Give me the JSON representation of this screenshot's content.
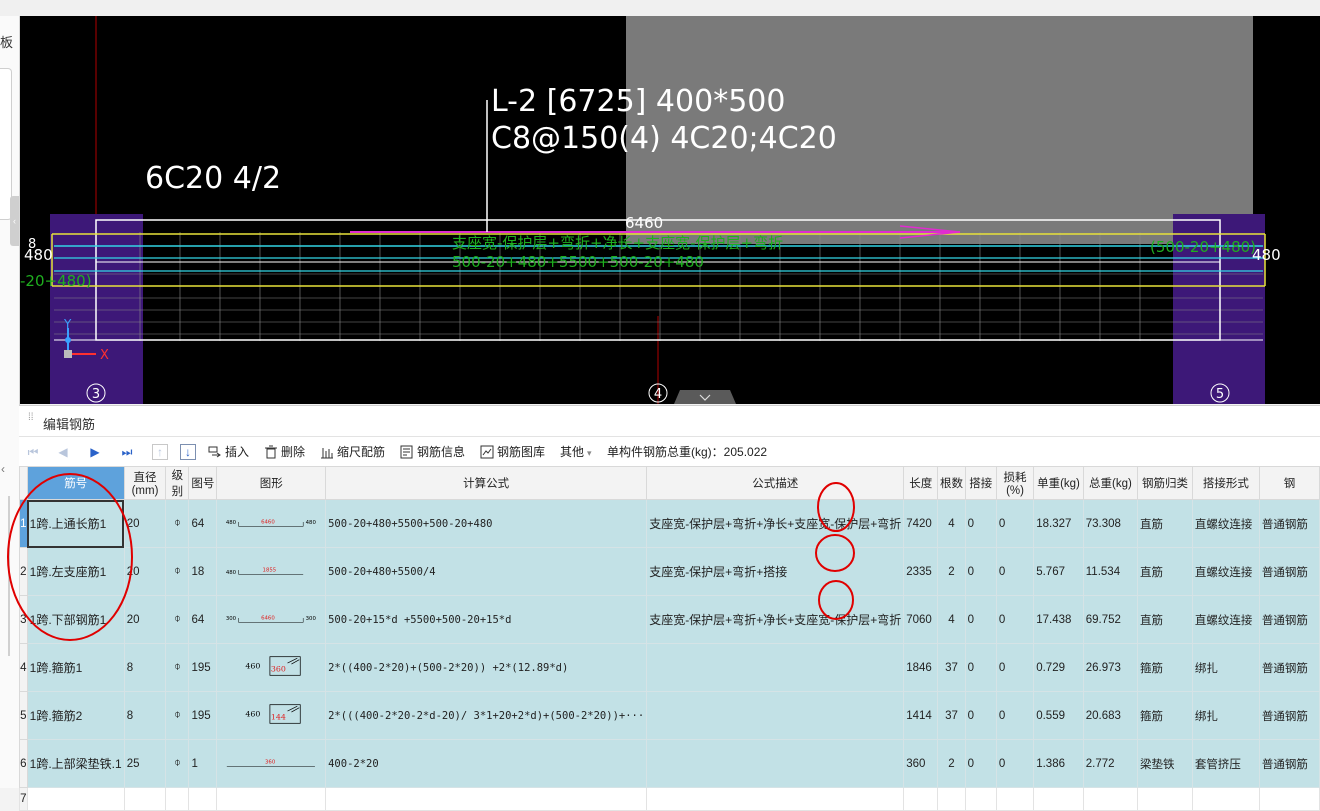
{
  "left_panel": {
    "label": "板",
    "tab_glyph": "‹",
    "chevron": "‹"
  },
  "cad": {
    "beam_label_line1": "L-2 [6725] 400*500",
    "beam_label_line2": "C8@150(4) 4C20;4C20",
    "support_label": "6C20 4/2",
    "span_length": "6460",
    "left_dim": "480",
    "right_dim": "480",
    "left_formula_frag": "-20+480)",
    "right_formula_frag": "(500-20+480)",
    "green_line1": "支座宽-保护层+弯折+净长+支座宽-保护层+弯折",
    "green_line2": "500-20+480+5500+500-20+480",
    "left_frag_b": "8",
    "axis_left": "3",
    "axis_mid": "4",
    "axis_right": "5",
    "axis_x": "X",
    "axis_y": "Y",
    "colors": {
      "support": "#3d1878",
      "support_edge": "#6a3bb4",
      "rebar_yellow": "#e8e23a",
      "rebar_cyan": "#33d6e6",
      "rebar_magenta": "#e02cd0",
      "green_text": "#1fae1f",
      "grid_red": "#b00000",
      "overlay_gray": "#7a7a7a"
    }
  },
  "panel": {
    "title": "编辑钢筋",
    "toolbar": {
      "first": "⏮",
      "prev": "◀",
      "next": "▶",
      "last": "⏭",
      "move_up": "↑",
      "move_down": "↓",
      "insert": "插入",
      "delete": "删除",
      "scale_rebar": "缩尺配筋",
      "rebar_info": "钢筋信息",
      "rebar_library": "钢筋图库",
      "other": "其他",
      "total_weight": "单构件钢筋总重(kg)：205.022"
    },
    "columns": [
      "筋号",
      "直径(mm)",
      "级别",
      "图号",
      "图形",
      "计算公式",
      "公式描述",
      "长度",
      "根数",
      "搭接",
      "损耗(%)",
      "单重(kg)",
      "总重(kg)",
      "钢筋归类",
      "搭接形式",
      "钢"
    ],
    "rows": [
      {
        "num": "1",
        "name": "1跨.上通长筋1",
        "dia": "20",
        "grade": "⌽",
        "fig": "64",
        "shape_left": "480",
        "shape_mid": "6460",
        "shape_right": "480",
        "formula": "500-20+480+5500+500-20+480",
        "desc": "支座宽-保护层+弯折+净长+支座宽-保护层+弯折",
        "len": "7420",
        "count": "4",
        "lap": "0",
        "loss": "0",
        "unit_w": "18.327",
        "total_w": "73.308",
        "category": "直筋",
        "lap_type": "直螺纹连接",
        "steel": "普通钢筋"
      },
      {
        "num": "2",
        "name": "1跨.左支座筋1",
        "dia": "20",
        "grade": "⌽",
        "fig": "18",
        "shape_left": "480",
        "shape_mid": "1855",
        "shape_right": "",
        "formula": "500-20+480+5500/4",
        "desc": "支座宽-保护层+弯折+搭接",
        "len": "2335",
        "count": "2",
        "lap": "0",
        "loss": "0",
        "unit_w": "5.767",
        "total_w": "11.534",
        "category": "直筋",
        "lap_type": "直螺纹连接",
        "steel": "普通钢筋"
      },
      {
        "num": "3",
        "name": "1跨.下部钢筋1",
        "dia": "20",
        "grade": "⌽",
        "fig": "64",
        "shape_left": "300",
        "shape_mid": "6460",
        "shape_right": "300",
        "formula": "500-20+15*d +5500+500-20+15*d",
        "desc": "支座宽-保护层+弯折+净长+支座宽-保护层+弯折",
        "len": "7060",
        "count": "4",
        "lap": "0",
        "loss": "0",
        "unit_w": "17.438",
        "total_w": "69.752",
        "category": "直筋",
        "lap_type": "直螺纹连接",
        "steel": "普通钢筋"
      },
      {
        "num": "4",
        "name": "1跨.箍筋1",
        "dia": "8",
        "grade": "⌽",
        "fig": "195",
        "shape_left": "460",
        "shape_mid": "360",
        "shape_right": "",
        "formula": "2*((400-2*20)+(500-2*20)) +2*(12.89*d)",
        "desc": "",
        "len": "1846",
        "count": "37",
        "lap": "0",
        "loss": "0",
        "unit_w": "0.729",
        "total_w": "26.973",
        "category": "箍筋",
        "lap_type": "绑扎",
        "steel": "普通钢筋"
      },
      {
        "num": "5",
        "name": "1跨.箍筋2",
        "dia": "8",
        "grade": "⌽",
        "fig": "195",
        "shape_left": "460",
        "shape_mid": "144",
        "shape_right": "",
        "formula": "2*(((400-2*20-2*d-20)/ 3*1+20+2*d)+(500-2*20))+···",
        "desc": "",
        "len": "1414",
        "count": "37",
        "lap": "0",
        "loss": "0",
        "unit_w": "0.559",
        "total_w": "20.683",
        "category": "箍筋",
        "lap_type": "绑扎",
        "steel": "普通钢筋"
      },
      {
        "num": "6",
        "name": "1跨.上部梁垫铁.1",
        "dia": "25",
        "grade": "⌽",
        "fig": "1",
        "shape_left": "",
        "shape_mid": "360",
        "shape_right": "",
        "formula": "400-2*20",
        "desc": "",
        "len": "360",
        "count": "2",
        "lap": "0",
        "loss": "0",
        "unit_w": "1.386",
        "total_w": "2.772",
        "category": "梁垫铁",
        "lap_type": "套管挤压",
        "steel": "普通钢筋"
      }
    ],
    "empty_row_num": "7"
  }
}
